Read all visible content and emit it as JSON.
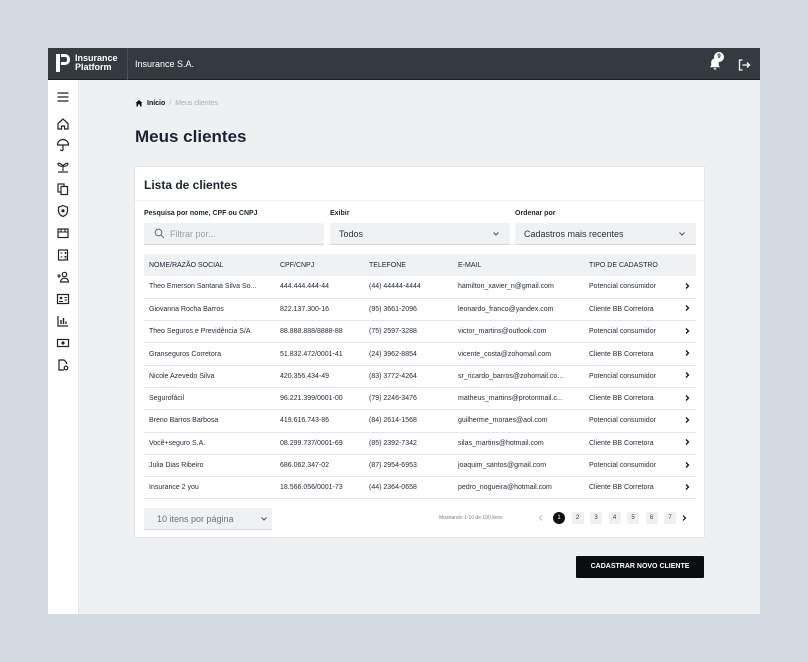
{
  "brand": {
    "line1": "Insurance",
    "line2": "Platform"
  },
  "topbar": {
    "company": "Insurance S.A.",
    "notifications": "9"
  },
  "breadcrumb": {
    "home": "Início",
    "separator": "/",
    "current": "Meus clientes"
  },
  "page_title": "Meus clientes",
  "card": {
    "title": "Lista de clientes",
    "search": {
      "label": "Pesquisa por nome, CPF ou CNPJ",
      "placeholder": "Filtrar por..."
    },
    "show": {
      "label": "Exibir",
      "value": "Todos"
    },
    "order": {
      "label": "Ordenar por",
      "value": "Cadastros mais recentes"
    }
  },
  "table": {
    "headers": [
      "NOME/RAZÃO SOCIAL",
      "CPF/CNPJ",
      "TELEFONE",
      "E-MAIL",
      "TIPO DE CADASTRO"
    ],
    "rows": [
      [
        "Theo Emerson Santana Silva So...",
        "444.444.444-44",
        "(44) 44444-4444",
        "hamilton_xavier_n@gmail.com",
        "Potencial consumidor"
      ],
      [
        "Giovanna Rocha Barros",
        "822.137.300-16",
        "(95) 3661-2096",
        "leonardo_franco@yandex.com",
        "Cliente BB Corretora"
      ],
      [
        "Theo Seguros e Previdência S/A",
        "88.888.888/8888-88",
        "(75) 2597-3288",
        "victor_martins@outlook.com",
        "Potencial consumidor"
      ],
      [
        "Granseguros Corretora",
        "51.832.472/0001-41",
        "(24) 3962-8854",
        "vicente_costa@zohomail.com",
        "Cliente BB Corretora"
      ],
      [
        "Nicole Azevedo Silva",
        "420.356.434-49",
        "(83) 3772-4264",
        "sr_ricardo_barros@zohomail.co...",
        "Potencial consumidor"
      ],
      [
        "Segurofácil",
        "96.221.399/0001-00",
        "(79) 2246-3476",
        "matheus_martins@protonmail.c...",
        "Cliente BB Corretora"
      ],
      [
        "Breno Barros Barbosa",
        "419.616.743-86",
        "(84) 2614-1568",
        "guilherme_moraes@aol.com",
        "Potencial consumidor"
      ],
      [
        "Você+seguro S.A.",
        "08.299.737/0001-69",
        "(85) 2392-7342",
        "silas_martins@hotmail.com",
        "Cliente BB Corretora"
      ],
      [
        "Julia Dias Ribeiro",
        "686.062.347-02",
        "(87) 2954-6953",
        "joaquim_santos@gmail.com",
        "Potencial consumidor"
      ],
      [
        "Insurance 2 you",
        "18.566.056/0001-73",
        "(44) 2364-0658",
        "pedro_nogueira@hotmail.com",
        "Cliente BB Corretora"
      ]
    ]
  },
  "pagination": {
    "per_page": "10 itens por página",
    "showing": "Mostrando 1-10 de 100 itens",
    "pages": [
      "1",
      "2",
      "3",
      "4",
      "5",
      "6",
      "7"
    ],
    "current_page": "1"
  },
  "cta_label": "CADASTRAR NOVO CLIENTE"
}
